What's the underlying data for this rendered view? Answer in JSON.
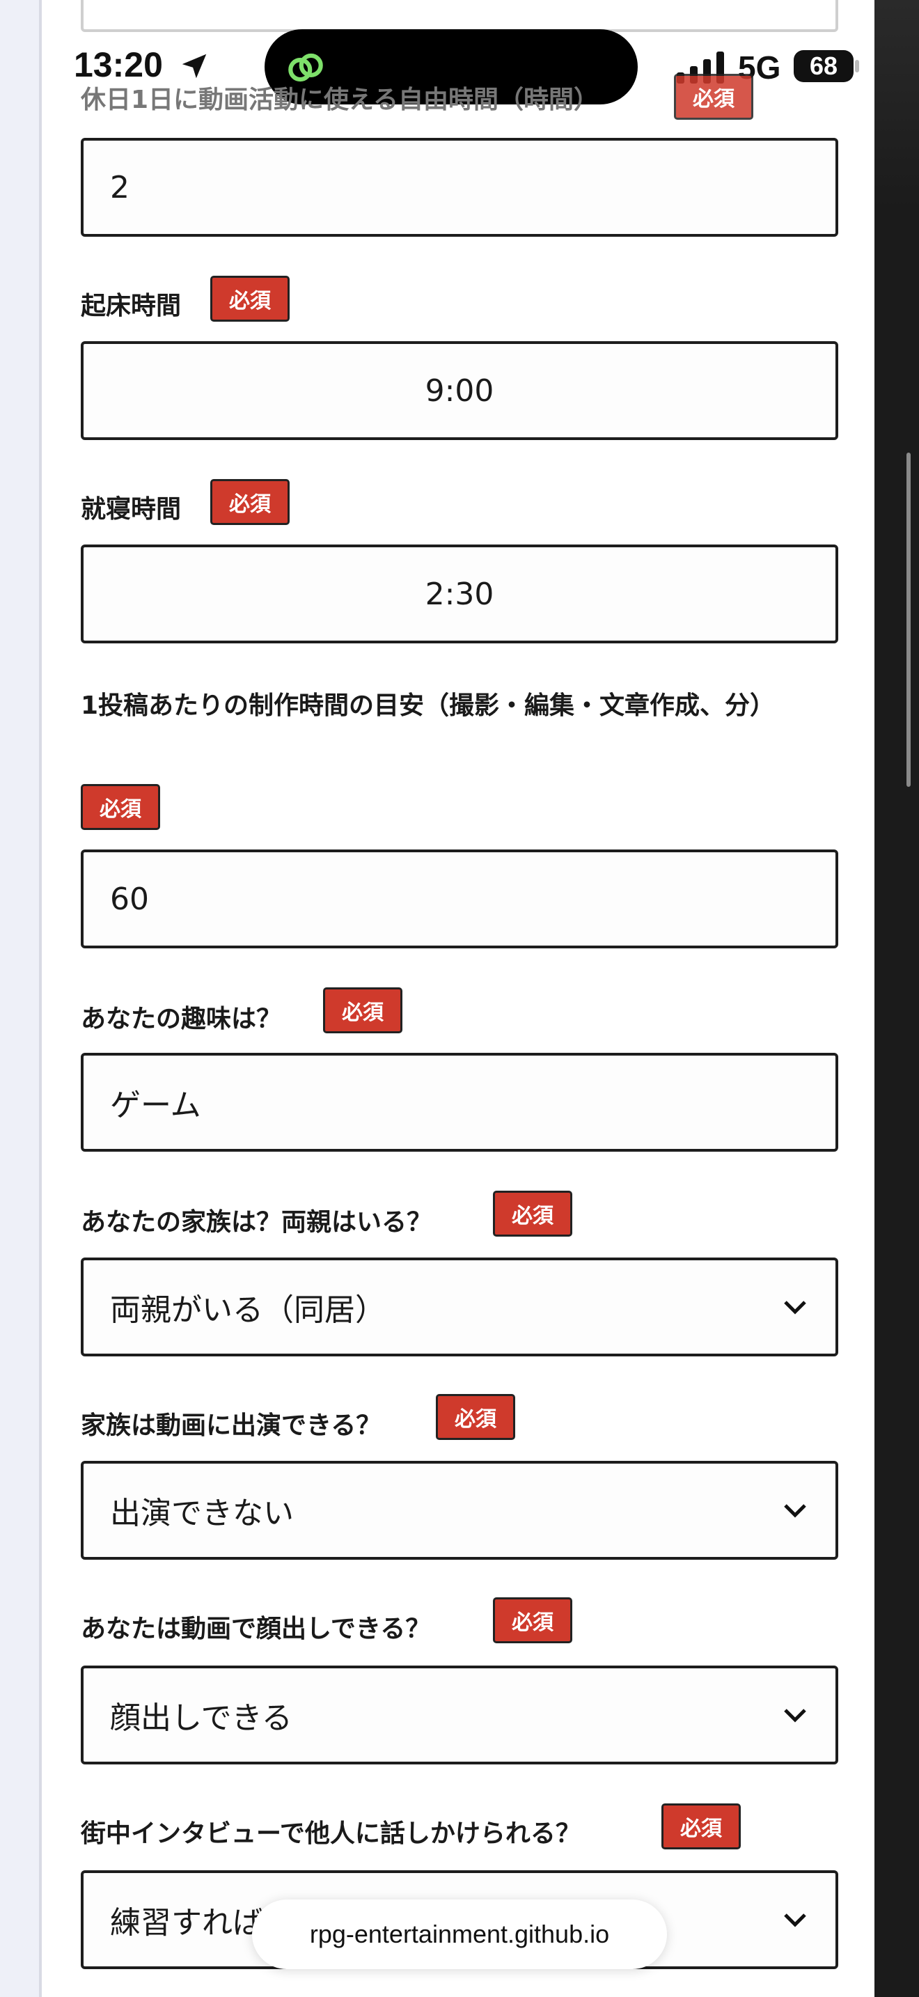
{
  "status_bar": {
    "time": "13:20",
    "network": "5G",
    "battery": "68"
  },
  "form": {
    "required_label": "必須",
    "holiday_label": "休日1日に動画活動に使える自由時間（時間）",
    "holiday_value": "2",
    "wake_label": "起床時間",
    "wake_value": "9:00",
    "sleep_label": "就寝時間",
    "sleep_value": "2:30",
    "production_label": "1投稿あたりの制作時間の目安（撮影・編集・文章作成、分）",
    "production_value": "60",
    "hobby_label": "あなたの趣味は？",
    "hobby_value": "ゲーム",
    "family_label": "あなたの家族は？両親はいる？",
    "family_value": "両親がいる（同居）",
    "family_appear_label": "家族は動画に出演できる？",
    "family_appear_value": "出演できない",
    "face_label": "あなたは動画で顔出しできる？",
    "face_value": "顔出しできる",
    "interview_label": "街中インタビューで他人に話しかけられる？",
    "interview_value": "練習すれば"
  },
  "browser": {
    "url": "rpg-entertainment.github.io"
  }
}
